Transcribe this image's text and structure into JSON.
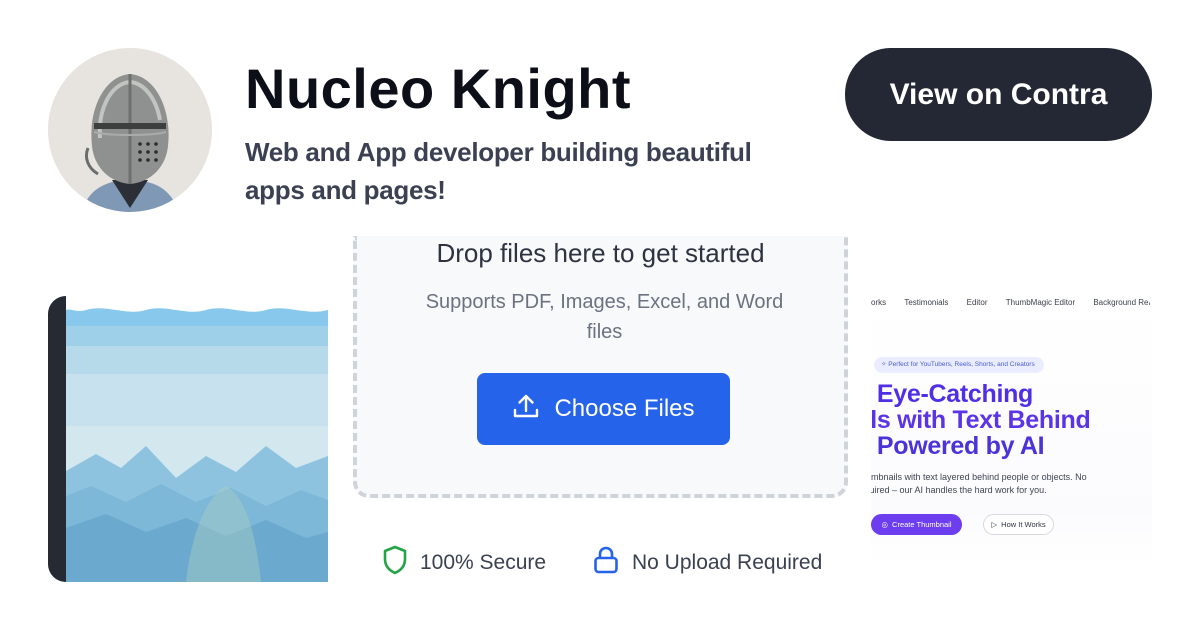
{
  "profile": {
    "name": "Nucleo Knight",
    "tagline": "Web and App developer building beautiful apps and pages!",
    "cta_label": "View on Contra"
  },
  "uploader": {
    "title": "Drop files here to get started",
    "subtitle": "Supports PDF, Images, Excel, and Word files",
    "button_label": "Choose Files",
    "button_icon": "upload-icon",
    "trust_badges": [
      {
        "icon": "shield-icon",
        "label": "100% Secure",
        "color": "#22a447"
      },
      {
        "icon": "lock-icon",
        "label": "No Upload Required",
        "color": "#2563eb"
      }
    ]
  },
  "thumbnail_site": {
    "nav": [
      "orks",
      "Testimonials",
      "Editor",
      "ThumbMagic Editor",
      "Background Remover"
    ],
    "pill": "Perfect for YouTubers, Reels, Shorts, and Creators",
    "headline": [
      "ate Eye-Catching",
      "nails with Text Behind",
      "n – Powered by AI"
    ],
    "description": [
      "onal thumbnails with text layered behind people or objects. No",
      "kills required – our AI handles the hard work for you."
    ],
    "primary_button": "Create Thumbnail",
    "secondary_button": "How It Works"
  },
  "colors": {
    "cta_bg": "#232834",
    "primary_blue": "#2563eb",
    "secure_green": "#22a447",
    "headline_purple": "#4f2fe6"
  }
}
